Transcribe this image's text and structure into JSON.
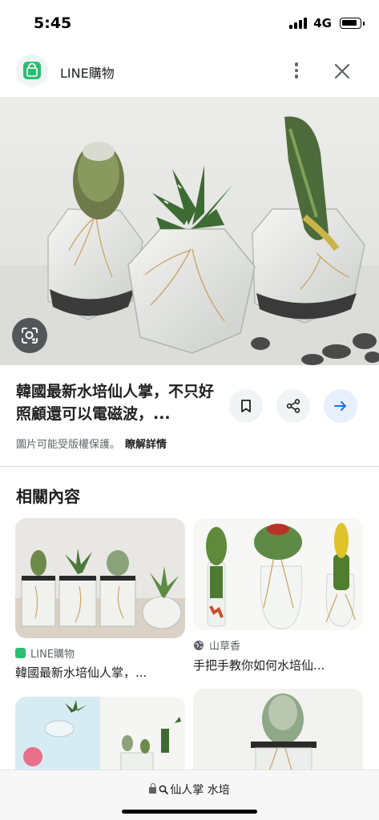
{
  "status_bar": {
    "time": "5:45",
    "network": "4G"
  },
  "header": {
    "app_name": "LINE購物",
    "logo_icon": "line-shopping-bag-icon",
    "brand_color": "#2dbc73"
  },
  "result": {
    "title": "韓國最新水培仙人掌，不只好照顧還可以電磁波，...",
    "copyright_notice": "圖片可能受版權保護。",
    "learn_more": "瞭解詳情"
  },
  "related": {
    "heading": "相關內容",
    "cards": [
      {
        "source": "LINE購物",
        "title": "韓國最新水培仙人掌，..."
      },
      {
        "source": "山草香",
        "title": "手把手教你如何水培仙..."
      }
    ]
  },
  "bottom_bar": {
    "url_text": "仙人掌 水培"
  }
}
